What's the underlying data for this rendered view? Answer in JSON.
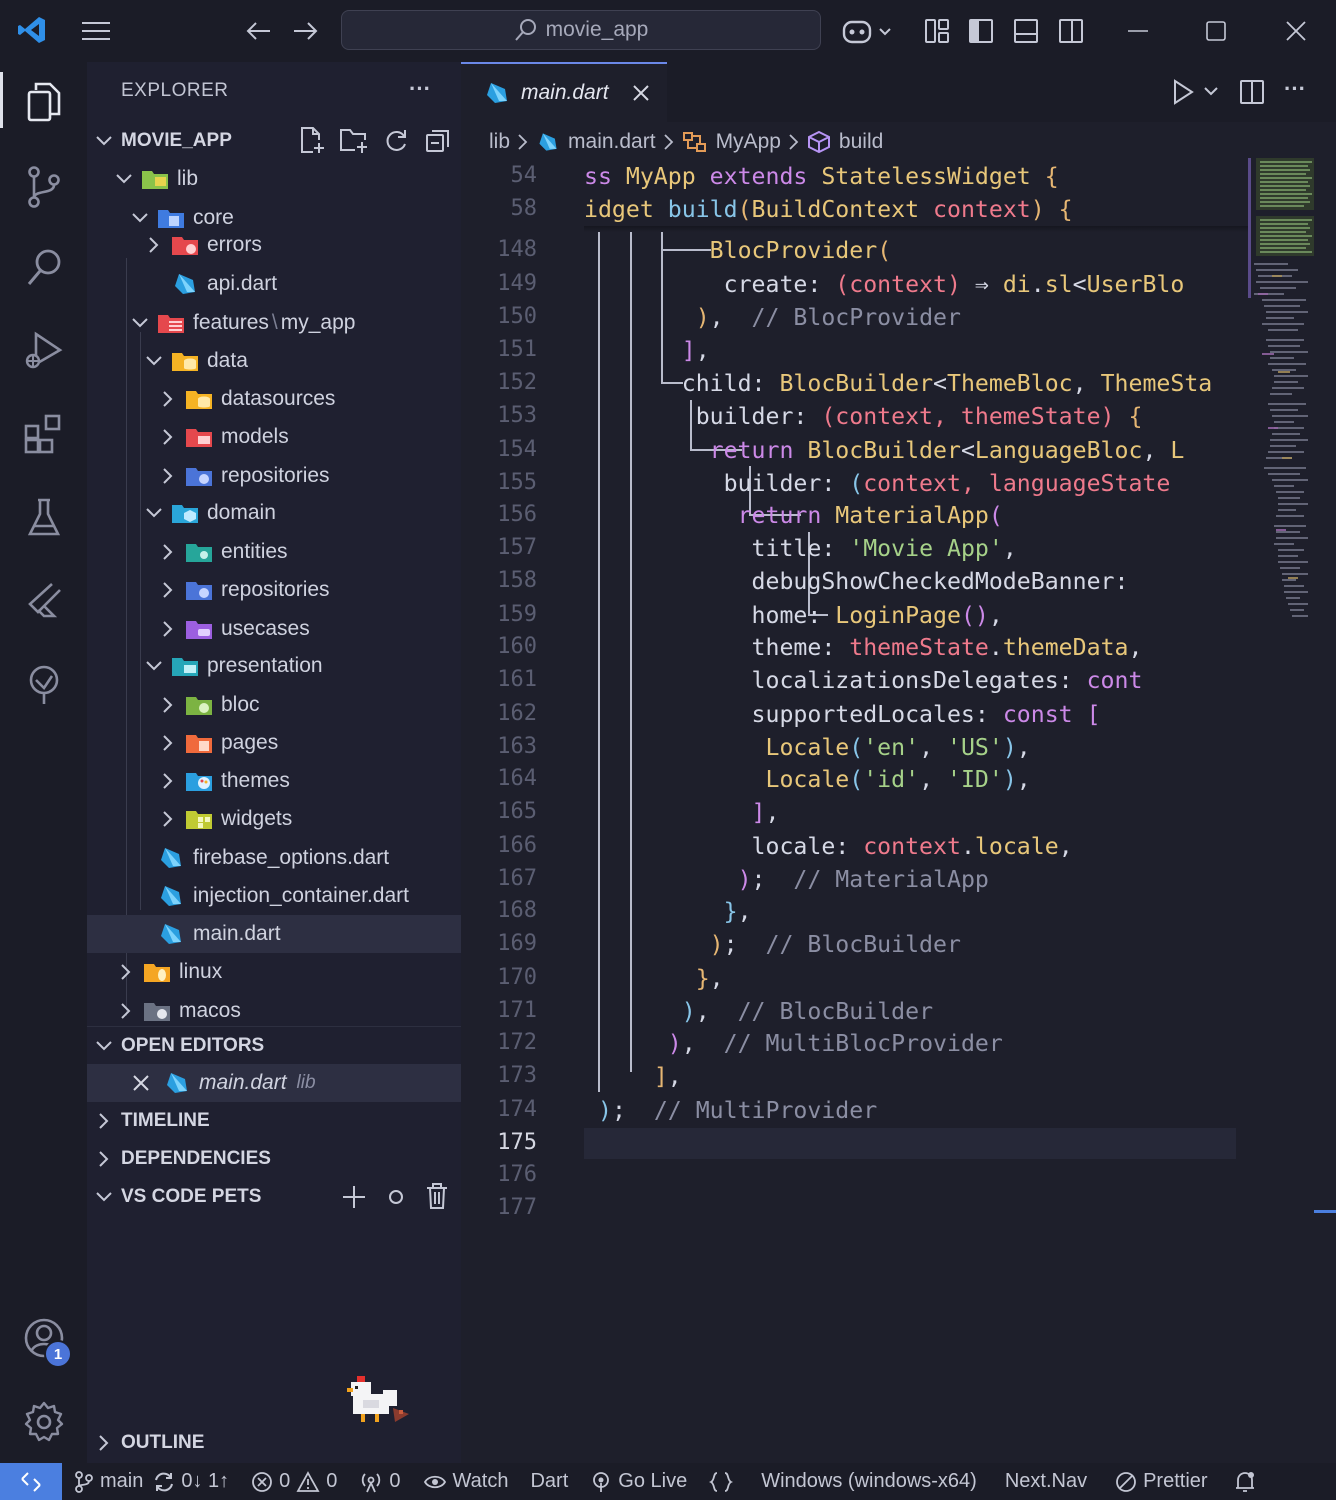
{
  "window": {
    "search_text": "movie_app"
  },
  "explorer": {
    "title": "EXPLORER",
    "more": "···",
    "root": "MOVIE_APP",
    "items": [
      {
        "label": "lib"
      },
      {
        "label": "core"
      },
      {
        "label": "errors"
      },
      {
        "label": "api.dart"
      },
      {
        "label": "features"
      },
      {
        "label": "data"
      },
      {
        "label": "datasources"
      },
      {
        "label": "models"
      },
      {
        "label": "repositories"
      },
      {
        "label": "domain"
      },
      {
        "label": "entities"
      },
      {
        "label": "repositories"
      },
      {
        "label": "usecases"
      },
      {
        "label": "presentation"
      },
      {
        "label": "bloc"
      },
      {
        "label": "pages"
      },
      {
        "label": "themes"
      },
      {
        "label": "widgets"
      },
      {
        "label": "firebase_options.dart"
      },
      {
        "label": "injection_container.dart"
      },
      {
        "label": "main.dart"
      },
      {
        "label": "linux"
      },
      {
        "label": "macos"
      }
    ],
    "features_sep": "\\",
    "features_sub": "my_app"
  },
  "sections": {
    "open_editors": "OPEN EDITORS",
    "open_editor_file": "main.dart",
    "open_editor_dir": "lib",
    "timeline": "TIMELINE",
    "dependencies": "DEPENDENCIES",
    "pets": "VS CODE PETS",
    "outline": "OUTLINE"
  },
  "editor": {
    "tab_label": "main.dart",
    "breadcrumb": [
      "lib",
      "main.dart",
      "MyApp",
      "build"
    ],
    "line_numbers": [
      "54",
      "58",
      "148",
      "149",
      "150",
      "151",
      "152",
      "153",
      "154",
      "155",
      "156",
      "157",
      "158",
      "159",
      "160",
      "161",
      "162",
      "163",
      "164",
      "165",
      "166",
      "167",
      "168",
      "169",
      "170",
      "171",
      "172",
      "173",
      "174",
      "175",
      "176",
      "177"
    ],
    "current_line": "175"
  },
  "statusbar": {
    "branch": "main",
    "sync": "0↓ 1↑",
    "errors": "0",
    "warnings": "0",
    "ports": "0",
    "watch": "Watch",
    "lang": "Dart",
    "golive": "Go Live",
    "platform": "Windows (windows-x64)",
    "nextnav": "Next.Nav",
    "prettier": "Prettier"
  },
  "accounts_badge": "1",
  "colors": {
    "accent": "#4b7fe0",
    "background": "#1e1f2b",
    "sidebar": "#1f2030"
  }
}
